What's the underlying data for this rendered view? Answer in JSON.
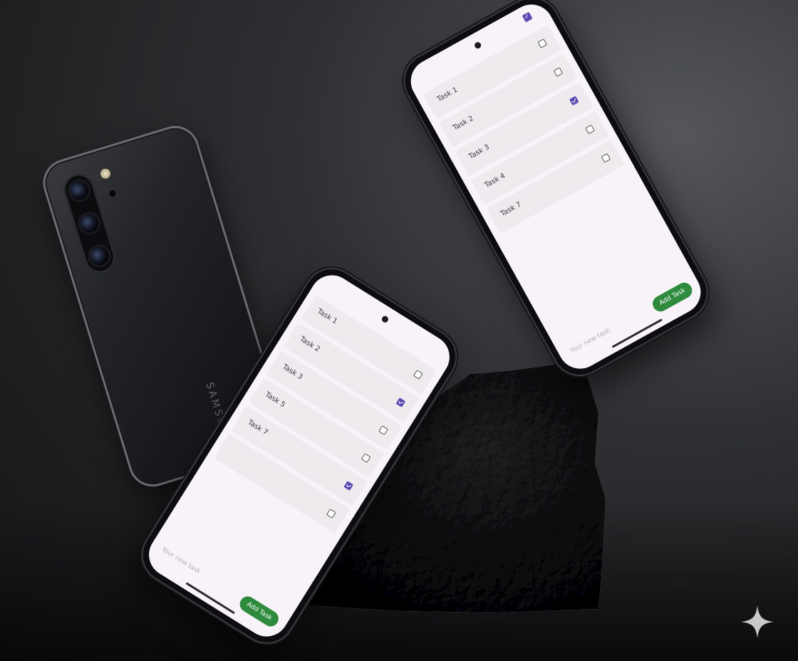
{
  "colors": {
    "checkbox_on": "#5b4bb3",
    "add_button": "#2e8b3e",
    "screen_bg": "#f8f3f8",
    "row_bg": "#efeaee"
  },
  "back_phone": {
    "brand": "SAMSUNG"
  },
  "phone_right": {
    "status_checkbox_checked": true,
    "tasks": [
      {
        "label": "Task 1",
        "checked": false
      },
      {
        "label": "Task 2",
        "checked": false
      },
      {
        "label": "Task 3",
        "checked": true
      },
      {
        "label": "Task 4",
        "checked": false
      },
      {
        "label": "Task 7",
        "checked": false
      }
    ],
    "input_placeholder": "Your new task",
    "add_button_label": "Add Task"
  },
  "phone_left": {
    "tasks": [
      {
        "label": "Task 1",
        "checked": false
      },
      {
        "label": "Task 2",
        "checked": true
      },
      {
        "label": "Task 3",
        "checked": false
      },
      {
        "label": "Task 5",
        "checked": false
      },
      {
        "label": "Task 7",
        "checked": true
      },
      {
        "label": "",
        "checked": false
      }
    ],
    "input_placeholder": "Your new task",
    "add_button_label": "Add Task"
  },
  "icons": {
    "watermark": "sparkle-icon"
  }
}
